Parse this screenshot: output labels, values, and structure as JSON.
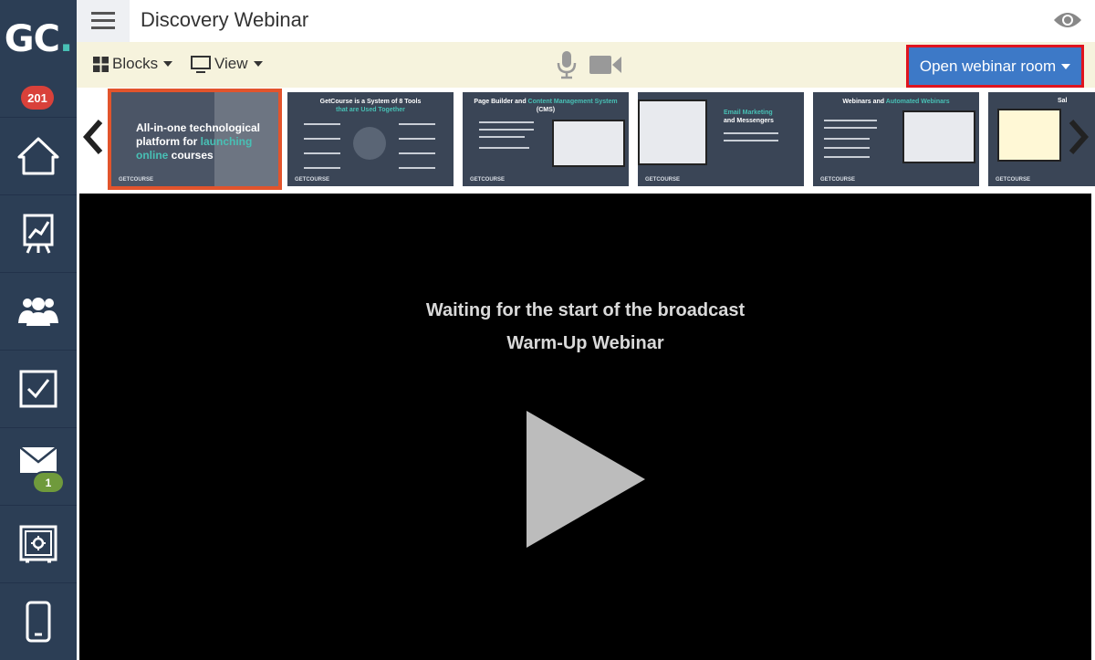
{
  "app": {
    "logo_text": "GC",
    "logo_dot": "."
  },
  "header": {
    "title": "Discovery Webinar"
  },
  "sidebar": {
    "count_badge": "201",
    "items": [
      {
        "name": "home",
        "icon": "home-icon"
      },
      {
        "name": "analytics",
        "icon": "chart-icon"
      },
      {
        "name": "users",
        "icon": "users-icon"
      },
      {
        "name": "tasks",
        "icon": "checkbox-icon"
      },
      {
        "name": "messages",
        "icon": "envelope-icon",
        "badge": "1"
      },
      {
        "name": "safe",
        "icon": "safe-icon"
      },
      {
        "name": "mobile",
        "icon": "phone-icon"
      }
    ]
  },
  "toolbar": {
    "blocks_label": "Blocks",
    "view_label": "View",
    "open_room_label": "Open webinar room"
  },
  "slides": [
    {
      "title_pre": "All-in-one technological platform for ",
      "title_accent": "launching",
      "title_post": "",
      "title_line2_accent": "online",
      "title_line2": " courses",
      "logo": "GETCOURSE"
    },
    {
      "title": "GetCourse is a System of 8 Tools",
      "title_accent": "that are Used Together",
      "logo": "GETCOURSE"
    },
    {
      "title": "Page Builder and ",
      "title_accent": "Content Management System",
      "title_post": "(CMS)",
      "logo": "GETCOURSE"
    },
    {
      "title_accent": "Email Marketing",
      "title_post": "and Messengers",
      "logo": "GETCOURSE"
    },
    {
      "title": "Webinars and ",
      "title_accent": "Automated Webinars",
      "logo": "GETCOURSE"
    },
    {
      "title": "Sal",
      "logo": "GETCOURSE"
    }
  ],
  "video": {
    "status_line1": "Waiting for the start of the broadcast",
    "status_line2": "Warm-Up Webinar"
  },
  "colors": {
    "sidebar_bg": "#2c3e55",
    "toolbar_bg": "#f6f3dd",
    "primary_button": "#3d79c7",
    "highlight_border": "#e0141e",
    "active_slide_border": "#e2542c",
    "accent_teal": "#48c0b5"
  }
}
